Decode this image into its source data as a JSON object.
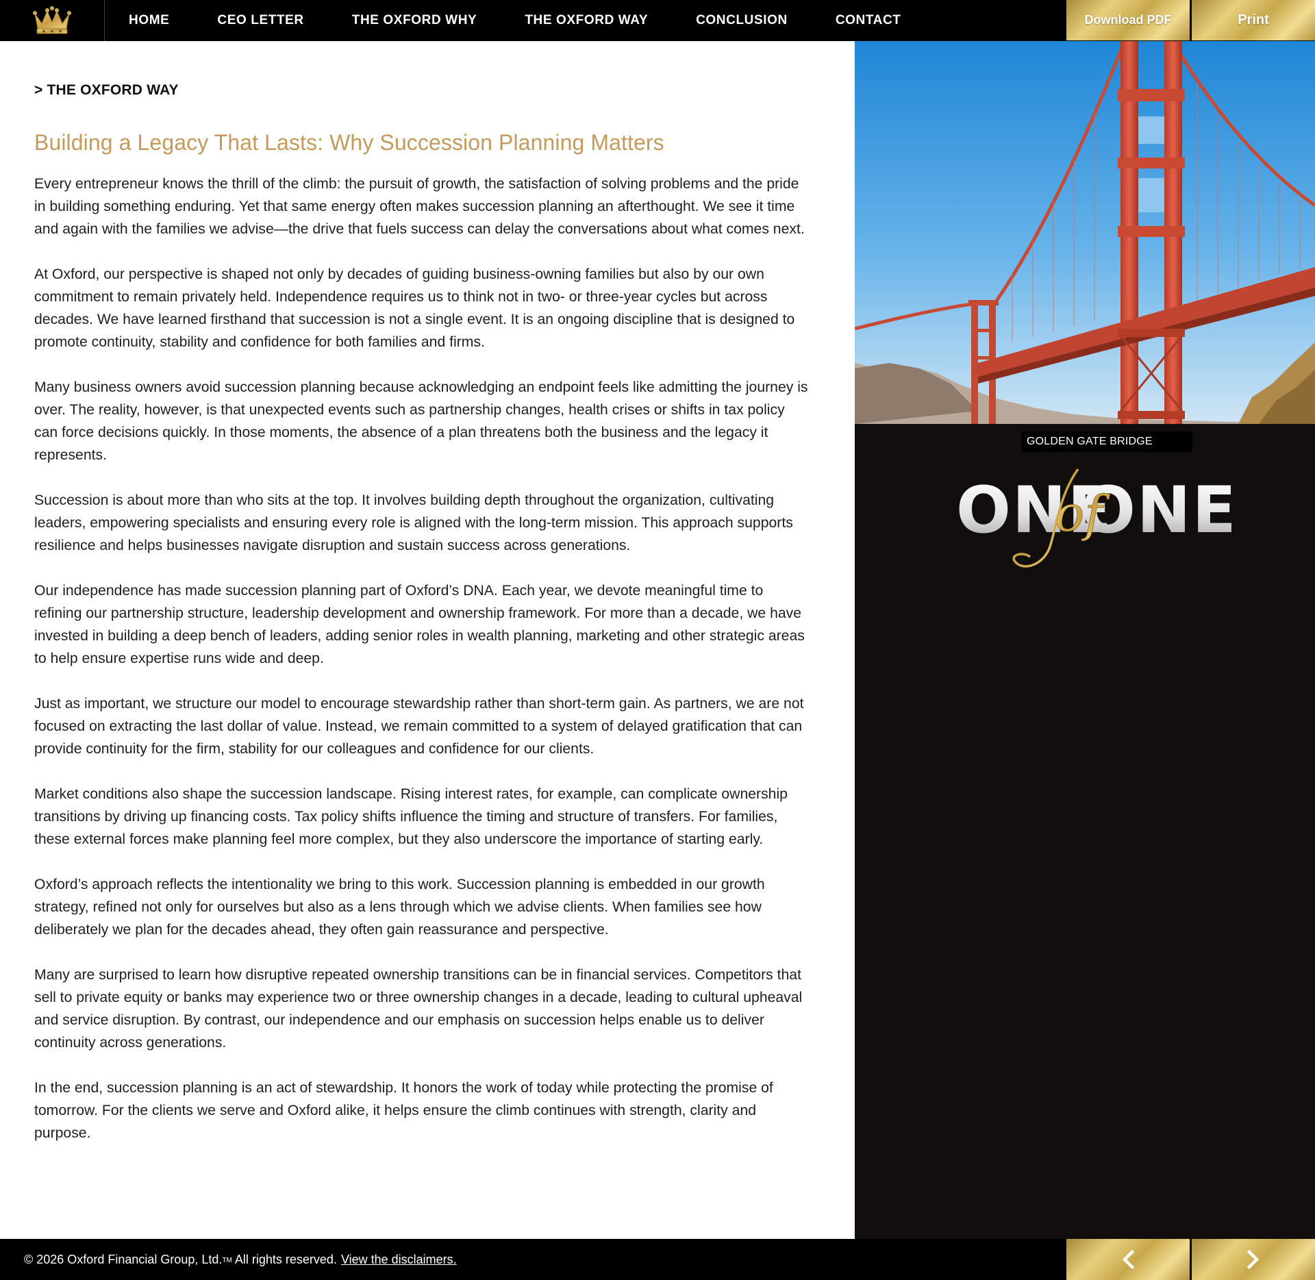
{
  "nav": {
    "logo_icon": "crown-icon",
    "items": [
      {
        "label": "HOME"
      },
      {
        "label": "CEO LETTER"
      },
      {
        "label": "THE OXFORD WHY"
      },
      {
        "label": "THE OXFORD WAY"
      },
      {
        "label": "CONCLUSION"
      },
      {
        "label": "CONTACT"
      }
    ],
    "download_label": "Download PDF",
    "print_label": "Print"
  },
  "main": {
    "breadcrumb": "> THE OXFORD WAY",
    "title": "Building a Legacy That Lasts: Why Succession Planning Matters",
    "paragraphs": [
      "Every entrepreneur knows the thrill of the climb: the pursuit of growth, the satisfaction of solving problems and the pride in building something enduring. Yet that same energy often makes succession planning an afterthought. We see it time and again with the families we advise—the drive that fuels success can delay the conversations about what comes next.",
      "At Oxford, our perspective is shaped not only by decades of guiding business-owning families but also by our own commitment to remain privately held. Independence requires us to think not in two- or three-year cycles but across decades. We have learned firsthand that succession is not a single event. It is an ongoing discipline that is designed to promote continuity, stability and confidence for both families and firms.",
      "Many business owners avoid succession planning because acknowledging an endpoint feels like admitting the journey is over. The reality, however, is that unexpected events such as partnership changes, health crises or shifts in tax policy can force decisions quickly. In those moments, the absence of a plan threatens both the business and the legacy it represents.",
      "Succession is about more than who sits at the top. It involves building depth throughout the organization, cultivating leaders, empowering specialists and ensuring every role is aligned with the long-term mission. This approach supports resilience and helps businesses navigate disruption and sustain success across generations.",
      "Our independence has made succession planning part of Oxford’s DNA. Each year, we devote meaningful time to refining our partnership structure, leadership development and ownership framework. For more than a decade, we have invested in building a deep bench of leaders, adding senior roles in wealth planning, marketing and other strategic areas to help ensure expertise runs wide and deep.",
      "Just as important, we structure our model to encourage stewardship rather than short-term gain. As partners, we are not focused on extracting the last dollar of value. Instead, we remain committed to a system of delayed gratification that can provide continuity for the firm, stability for our colleagues and confidence for our clients.",
      "Market conditions also shape the succession landscape. Rising interest rates, for example, can complicate ownership transitions by driving up financing costs. Tax policy shifts influence the timing and structure of transfers. For families, these external forces make planning feel more complex, but they also underscore the importance of starting early.",
      "Oxford’s approach reflects the intentionality we bring to this work. Succession planning is embedded in our growth strategy, refined not only for ourselves but also as a lens through which we advise clients. When families see how deliberately we plan for the decades ahead, they often gain reassurance and perspective.",
      "Many are surprised to learn how disruptive repeated ownership transitions can be in financial services. Competitors that sell to private equity or banks may experience two or three ownership changes in a decade, leading to cultural upheaval and service disruption. By contrast, our independence and our emphasis on succession helps enable us to deliver continuity across generations.",
      "In the end, succession planning is an act of stewardship. It honors the work of today while protecting the promise of tomorrow. For the clients we serve and Oxford alike, it helps ensure the climb continues with strength, clarity and purpose."
    ]
  },
  "side": {
    "caption": "GOLDEN GATE BRIDGE",
    "logo_text": "ONE of ONE",
    "logo_left": "ONE",
    "logo_script": "of",
    "logo_right": "ONE"
  },
  "footer": {
    "copyright": "© 2026 Oxford Financial Group, Ltd.",
    "tm": "TM",
    "rights": " All rights reserved.",
    "disclaimer_link": "View the disclaimers.",
    "prev_icon": "chevron-left-icon",
    "next_icon": "chevron-right-icon"
  },
  "colors": {
    "nav_bg": "#000000",
    "accent_gold": "#c59a5a",
    "side_bg": "#120e0e"
  }
}
